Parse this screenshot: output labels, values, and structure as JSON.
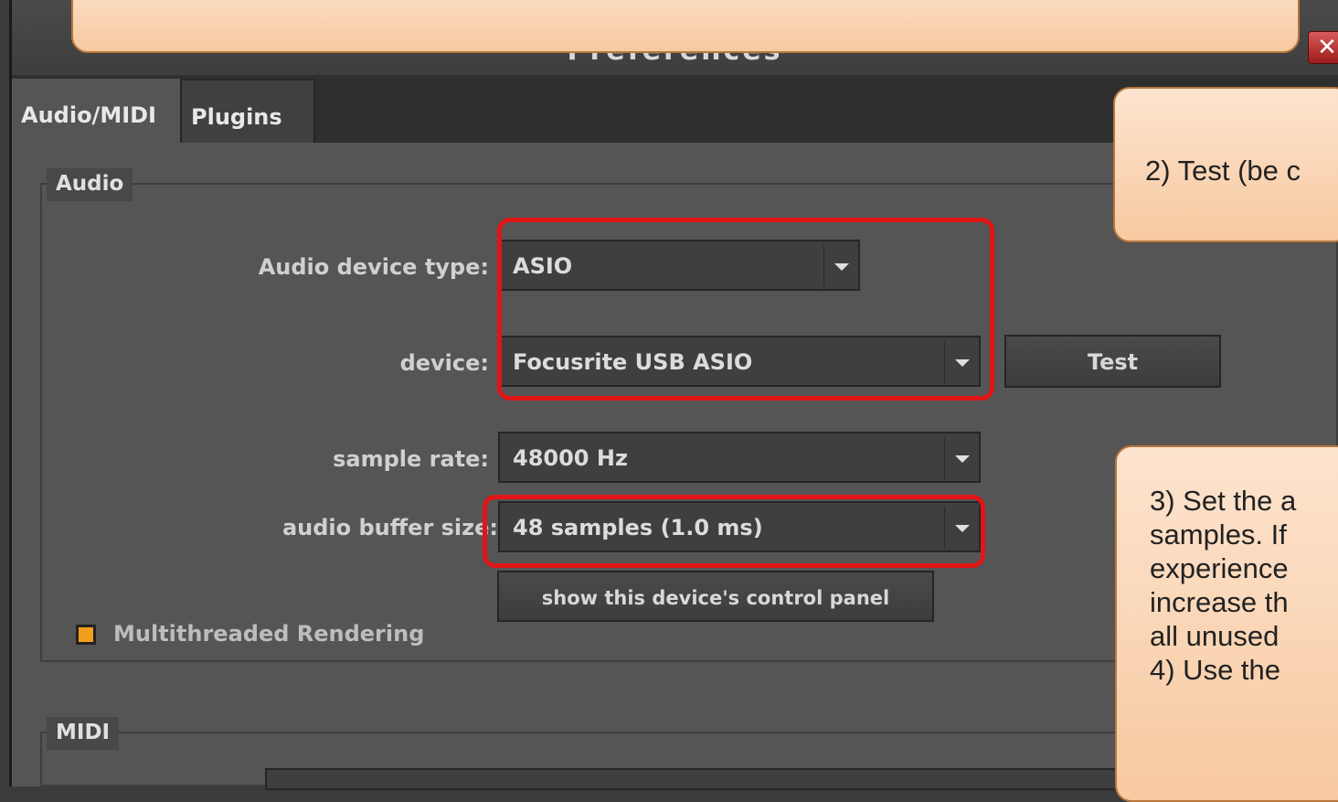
{
  "window": {
    "title": "Preferences",
    "close_glyph": "✕"
  },
  "tabs": [
    {
      "label": "Audio/MIDI",
      "active": true
    },
    {
      "label": "Plugins",
      "active": false
    }
  ],
  "audio_group": {
    "label": "Audio",
    "device_type_label": "Audio device type:",
    "device_type_value": "ASIO",
    "device_label": "device:",
    "device_value": "Focusrite USB ASIO",
    "test_button": "Test",
    "sample_rate_label": "sample rate:",
    "sample_rate_value": "48000 Hz",
    "buffer_label": "audio buffer size:",
    "buffer_value": "48 samples (1.0 ms)",
    "control_panel_button": "show this device's control panel",
    "multithread_label": "Multithreaded Rendering",
    "multithread_checked": true
  },
  "midi_group": {
    "label": "MIDI"
  },
  "callouts": {
    "test": "2) Test (be c",
    "buffer_lines": [
      "3) Set the a",
      "samples. If",
      "experience",
      "increase th",
      "all unused",
      "4) Use the"
    ]
  },
  "colors": {
    "highlight": "#e01515",
    "callout_bg": "#fbd7b8",
    "checkbox": "#f0a01a"
  }
}
